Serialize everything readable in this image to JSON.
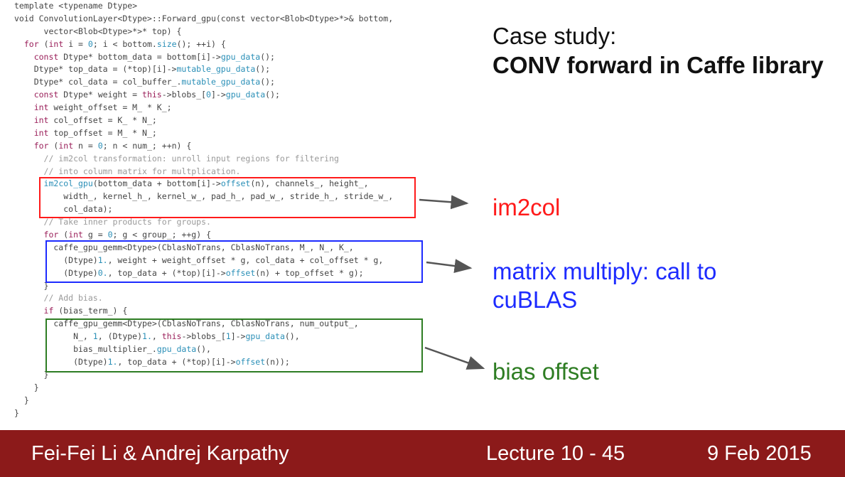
{
  "slide": {
    "title_line1": "Case study:",
    "title_line2": "CONV forward in Caffe library"
  },
  "code_lines": [
    [
      [
        "p",
        "template <typename Dtype>"
      ]
    ],
    [
      [
        "p",
        "void ConvolutionLayer<Dtype>::Forward_gpu(const vector<Blob<Dtype>*>& bottom,"
      ]
    ],
    [
      [
        "p",
        "      vector<Blob<Dtype>*>* top) {"
      ]
    ],
    [
      [
        "p",
        "  "
      ],
      [
        "kw",
        "for"
      ],
      [
        "p",
        " ("
      ],
      [
        "kw",
        "int"
      ],
      [
        "p",
        " i = "
      ],
      [
        "num",
        "0"
      ],
      [
        "p",
        "; i < bottom."
      ],
      [
        "fn",
        "size"
      ],
      [
        "p",
        "(); ++i) {"
      ]
    ],
    [
      [
        "p",
        "    "
      ],
      [
        "kw",
        "const"
      ],
      [
        "p",
        " Dtype* bottom_data = bottom[i]->"
      ],
      [
        "fn",
        "gpu_data"
      ],
      [
        "p",
        "();"
      ]
    ],
    [
      [
        "p",
        "    Dtype* top_data = (*top)[i]->"
      ],
      [
        "fn",
        "mutable_gpu_data"
      ],
      [
        "p",
        "();"
      ]
    ],
    [
      [
        "p",
        "    Dtype* col_data = col_buffer_."
      ],
      [
        "fn",
        "mutable_gpu_data"
      ],
      [
        "p",
        "();"
      ]
    ],
    [
      [
        "p",
        "    "
      ],
      [
        "kw",
        "const"
      ],
      [
        "p",
        " Dtype* weight = "
      ],
      [
        "kw",
        "this"
      ],
      [
        "p",
        "->blobs_["
      ],
      [
        "num",
        "0"
      ],
      [
        "p",
        "]->"
      ],
      [
        "fn",
        "gpu_data"
      ],
      [
        "p",
        "();"
      ]
    ],
    [
      [
        "p",
        "    "
      ],
      [
        "kw",
        "int"
      ],
      [
        "p",
        " weight_offset = M_ * K_;"
      ]
    ],
    [
      [
        "p",
        "    "
      ],
      [
        "kw",
        "int"
      ],
      [
        "p",
        " col_offset = K_ * N_;"
      ]
    ],
    [
      [
        "p",
        "    "
      ],
      [
        "kw",
        "int"
      ],
      [
        "p",
        " top_offset = M_ * N_;"
      ]
    ],
    [
      [
        "p",
        "    "
      ],
      [
        "kw",
        "for"
      ],
      [
        "p",
        " ("
      ],
      [
        "kw",
        "int"
      ],
      [
        "p",
        " n = "
      ],
      [
        "num",
        "0"
      ],
      [
        "p",
        "; n < num_; ++n) {"
      ]
    ],
    [
      [
        "cm",
        "      // im2col transformation: unroll input regions for filtering"
      ]
    ],
    [
      [
        "cm",
        "      // into column matrix for multplication."
      ]
    ],
    [
      [
        "p",
        "      "
      ],
      [
        "fn",
        "im2col_gpu"
      ],
      [
        "p",
        "(bottom_data + bottom[i]->"
      ],
      [
        "fn",
        "offset"
      ],
      [
        "p",
        "(n), channels_, height_,"
      ]
    ],
    [
      [
        "p",
        "          width_, kernel_h_, kernel_w_, pad_h_, pad_w_, stride_h_, stride_w_,"
      ]
    ],
    [
      [
        "p",
        "          col_data);"
      ]
    ],
    [
      [
        "cm",
        "      // Take inner products for groups."
      ]
    ],
    [
      [
        "p",
        "      "
      ],
      [
        "kw",
        "for"
      ],
      [
        "p",
        " ("
      ],
      [
        "kw",
        "int"
      ],
      [
        "p",
        " g = "
      ],
      [
        "num",
        "0"
      ],
      [
        "p",
        "; g < group_; ++g) {"
      ]
    ],
    [
      [
        "p",
        "        caffe_gpu_gemm<Dtype>(CblasNoTrans, CblasNoTrans, M_, N_, K_,"
      ]
    ],
    [
      [
        "p",
        "          (Dtype)"
      ],
      [
        "num",
        "1."
      ],
      [
        "p",
        ", weight + weight_offset * g, col_data + col_offset * g,"
      ]
    ],
    [
      [
        "p",
        "          (Dtype)"
      ],
      [
        "num",
        "0."
      ],
      [
        "p",
        ", top_data + (*top)[i]->"
      ],
      [
        "fn",
        "offset"
      ],
      [
        "p",
        "(n) + top_offset * g);"
      ]
    ],
    [
      [
        "p",
        "      }"
      ]
    ],
    [
      [
        "cm",
        "      // Add bias."
      ]
    ],
    [
      [
        "p",
        "      "
      ],
      [
        "kw",
        "if"
      ],
      [
        "p",
        " (bias_term_) {"
      ]
    ],
    [
      [
        "p",
        "        caffe_gpu_gemm<Dtype>(CblasNoTrans, CblasNoTrans, num_output_,"
      ]
    ],
    [
      [
        "p",
        "            N_, "
      ],
      [
        "num",
        "1"
      ],
      [
        "p",
        ", (Dtype)"
      ],
      [
        "num",
        "1."
      ],
      [
        "p",
        ", "
      ],
      [
        "kw",
        "this"
      ],
      [
        "p",
        "->blobs_["
      ],
      [
        "num",
        "1"
      ],
      [
        "p",
        "]->"
      ],
      [
        "fn",
        "gpu_data"
      ],
      [
        "p",
        "(),"
      ]
    ],
    [
      [
        "p",
        "            bias_multiplier_."
      ],
      [
        "fn",
        "gpu_data"
      ],
      [
        "p",
        "(),"
      ]
    ],
    [
      [
        "p",
        "            (Dtype)"
      ],
      [
        "num",
        "1."
      ],
      [
        "p",
        ", top_data + (*top)[i]->"
      ],
      [
        "fn",
        "offset"
      ],
      [
        "p",
        "(n));"
      ]
    ],
    [
      [
        "p",
        "      }"
      ]
    ],
    [
      [
        "p",
        "    }"
      ]
    ],
    [
      [
        "p",
        "  }"
      ]
    ],
    [
      [
        "p",
        "}"
      ]
    ]
  ],
  "annotations": {
    "im2col": "im2col",
    "gemm": "matrix multiply: call to cuBLAS",
    "bias": "bias offset"
  },
  "colors": {
    "im2col": "#ff1a1a",
    "gemm": "#1d2bff",
    "bias": "#2e7d23",
    "footer_bg": "#8c1a1a"
  },
  "footer": {
    "authors": "Fei-Fei Li & Andrej Karpathy",
    "lecture": "Lecture 10 - 45",
    "date": "9 Feb 2015"
  }
}
